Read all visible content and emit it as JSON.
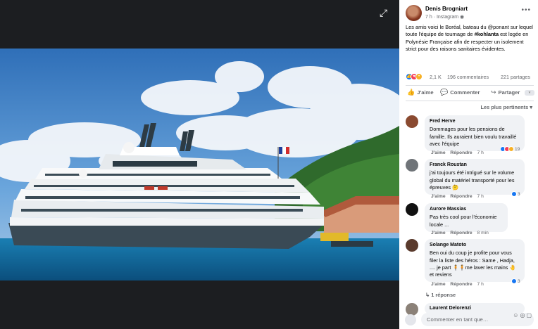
{
  "post": {
    "author": "Denis Brogniart",
    "time": "7 h",
    "source": "Instagram",
    "caption_pre": "Les amis voici le Boréal, bateau du @ponant sur lequel toute l'équipe de tournage de ",
    "caption_tag": "#kohlanta",
    "caption_post": " est logée en Polynésie Française afin de respecter un isolement strict pour des raisons sanitaires évidentes.",
    "reactions": "2,1 K",
    "comments": "196 commentaires",
    "shares": "221 partages",
    "ship_name": "LE BOREAL",
    "brand": "PONANT"
  },
  "actions": {
    "like": "J'aime",
    "comment": "Commenter",
    "share": "Partager"
  },
  "sort_label": "Les plus pertinents",
  "comments": [
    {
      "name": "Fred Herve",
      "text": "Dommages pour les pensions de famille. Ils auraient bien voulu travaillé avec l'équipe",
      "like": "J'aime",
      "reply": "Répondre",
      "time": "7 h",
      "reactions": "19",
      "avatar_color": "#8a4a30"
    },
    {
      "name": "Franck Roustan",
      "text": "j'ai toujours été intrigué sur le volume global du matériel transporté pour les épreuves 🤔",
      "like": "J'aime",
      "reply": "Répondre",
      "time": "7 h",
      "reactions": "3",
      "avatar_color": "#6f7478"
    },
    {
      "name": "Aurore Massias",
      "text": "Pas très cool pour l'économie locale ...",
      "like": "J'aime",
      "reply": "Répondre",
      "time": "8 min",
      "reactions": "",
      "avatar_color": "#111111"
    },
    {
      "name": "Solange Matoto",
      "text": "Ben oui du coup je profite pour vous filer la liste des héros : Same , Hadja, .... je part 🧍🧍me laver les mains 🤚 et reviens",
      "like": "J'aime",
      "reply": "Répondre",
      "time": "7 h",
      "reactions": "3",
      "avatar_color": "#5a3a2c"
    },
    {
      "name": "Laurent Delorenzi",
      "text": "",
      "avatar_color": "#8b8178"
    }
  ],
  "replies_label": "1 réponse",
  "composer": {
    "placeholder": "Commenter en tant que…"
  },
  "colors": {
    "accent": "#1877f2",
    "bubble": "#f0f2f5",
    "muted": "#65676b"
  }
}
